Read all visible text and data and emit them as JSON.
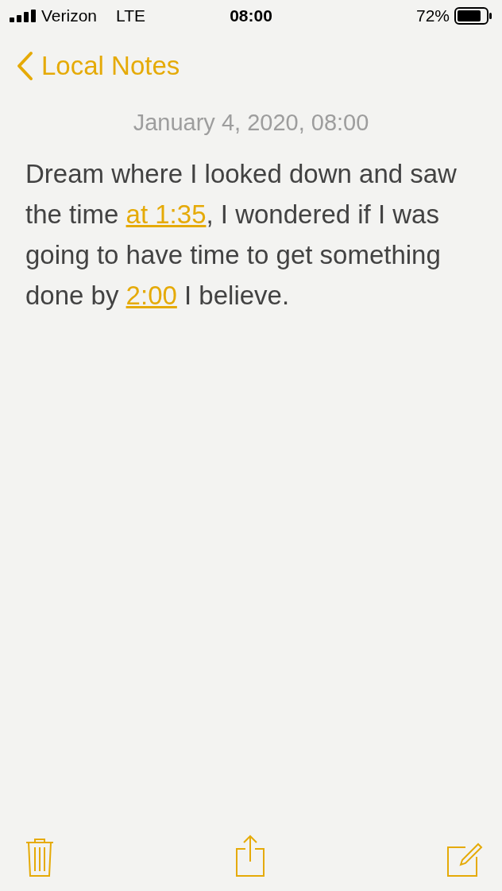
{
  "status_bar": {
    "carrier": "Verizon",
    "network": "LTE",
    "time": "08:00",
    "battery": "72%"
  },
  "nav": {
    "back_label": "Local Notes"
  },
  "note": {
    "date": "January 4, 2020, 08:00",
    "body": [
      {
        "kind": "text",
        "text": "Dream where I looked down and saw the time "
      },
      {
        "kind": "link",
        "text": "at 1:35"
      },
      {
        "kind": "text",
        "text": ", I wondered if I was going to have time to get something done by "
      },
      {
        "kind": "link",
        "text": "2:00"
      },
      {
        "kind": "text",
        "text": " I believe."
      }
    ]
  },
  "toolbar": [
    {
      "kind": "trash"
    },
    {
      "kind": "share"
    },
    {
      "kind": "compose"
    }
  ]
}
